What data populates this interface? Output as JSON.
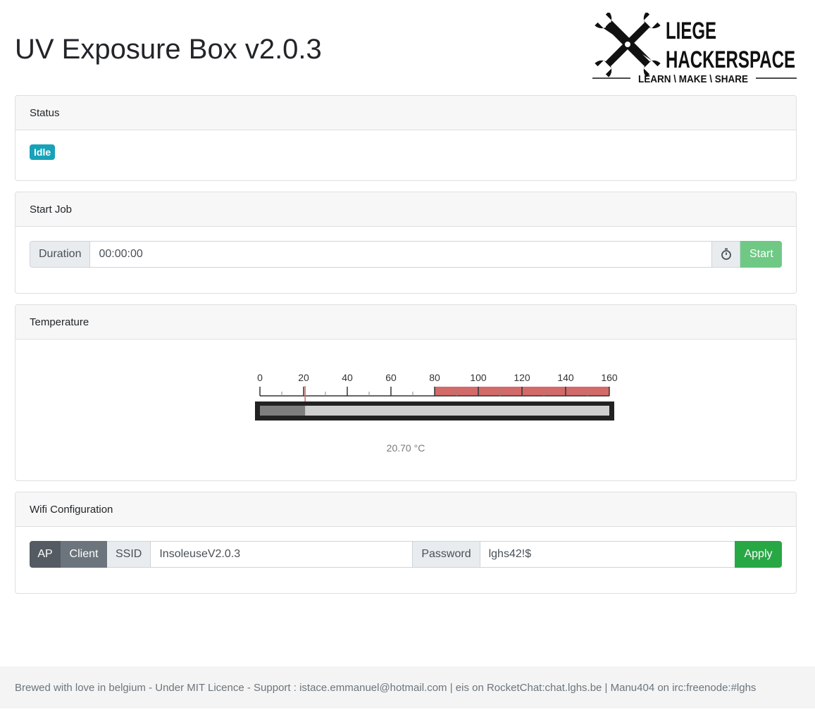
{
  "page": {
    "title": "UV Exposure Box v2.0.3"
  },
  "logo": {
    "line1": "LIEGE",
    "line2": "HACKERSPACE",
    "tagline": "LEARN \\ MAKE \\ SHARE"
  },
  "status": {
    "header": "Status",
    "badge": "Idle",
    "badge_color": "#17a2b8"
  },
  "start_job": {
    "header": "Start Job",
    "duration_label": "Duration",
    "duration_value": "00:00:00",
    "timer_icon": "stopwatch-icon",
    "start_label": "Start",
    "start_color": "#6fc985"
  },
  "temperature": {
    "header": "Temperature",
    "value": 20.7,
    "min": 0,
    "max": 160,
    "danger_from": 80,
    "ticks": [
      "0",
      "20",
      "40",
      "60",
      "80",
      "100",
      "120",
      "140",
      "160"
    ],
    "readout": "20.70 °C",
    "danger_color": "#d26a6a"
  },
  "wifi": {
    "header": "Wifi Configuration",
    "mode_ap": "AP",
    "mode_client": "Client",
    "ssid_label": "SSID",
    "ssid_value": "InsoleuseV2.0.3",
    "password_label": "Password",
    "password_value": "lghs42!$",
    "apply_label": "Apply",
    "apply_color": "#28a745"
  },
  "footer": {
    "text": "Brewed with love in belgium - Under MIT Licence - Support : istace.emmanuel@hotmail.com | eis on RocketChat:chat.lghs.be | Manu404 on irc:freenode:#lghs"
  }
}
